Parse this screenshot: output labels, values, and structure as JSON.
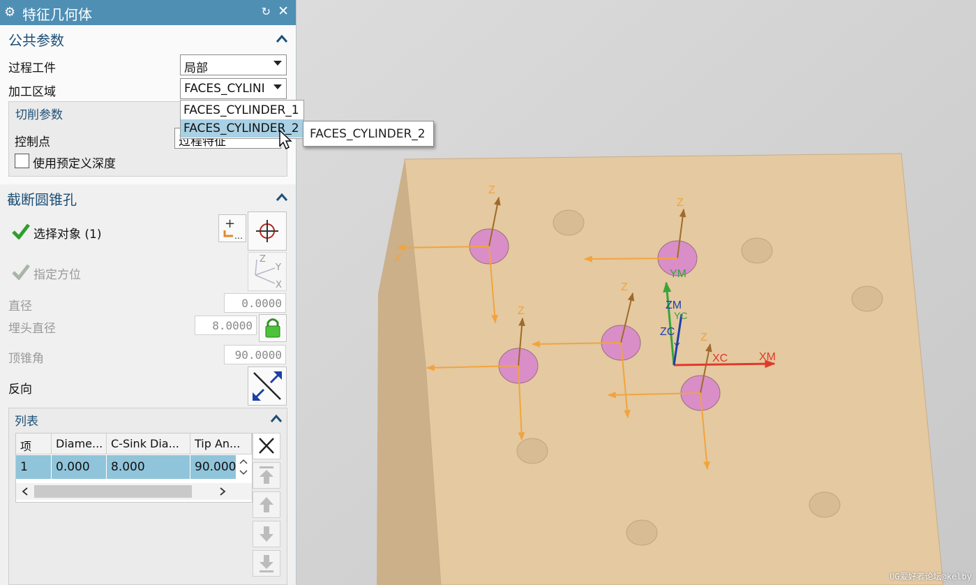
{
  "dialog": {
    "title": "特征几何体",
    "gear_icon": "⚙",
    "reset_icon": "↻",
    "close_icon": "✕",
    "common_params": {
      "title": "公共参数",
      "process_workpiece_label": "过程工件",
      "process_workpiece_value": "局部",
      "machining_area_label": "加工区域",
      "machining_area_value": "FACES_CYLINI",
      "cut_params": {
        "title": "切削参数",
        "control_point_label": "控制点",
        "control_point_value": "过程特征",
        "predef_depth_label": "使用预定义深度",
        "predef_depth_checked": false
      }
    },
    "dropdown": {
      "options": [
        "FACES_CYLINDER_1",
        "FACES_CYLINDER_2"
      ],
      "selected_index": 1
    },
    "tooltip": "FACES_CYLINDER_2",
    "truncated_cone_hole": {
      "title": "截断圆锥孔",
      "select_object_label": "选择对象 (1)",
      "specify_orientation_label": "指定方位",
      "orient_x": "X",
      "orient_y": "Y",
      "orient_z": "Z",
      "diameter_label": "直径",
      "diameter_value": "0.0000",
      "csink_label": "埋头直径",
      "csink_value": "8.0000",
      "tip_angle_label": "顶锥角",
      "tip_angle_value": "90.0000",
      "reverse_label": "反向"
    },
    "list": {
      "title": "列表",
      "columns": [
        "项",
        "Diame...",
        "C-Sink Dia...",
        "Tip An..."
      ],
      "rows": [
        [
          "1",
          "0.000",
          "8.000",
          "90.000"
        ]
      ]
    }
  },
  "viewport": {
    "axis_labels": {
      "z": "Z",
      "x": "X",
      "ym": "YM",
      "zm": "ZM",
      "yc": "YC",
      "zc": "ZC",
      "y": "Y",
      "xc": "XC",
      "xm": "XM"
    },
    "watermark": "UG爱好者论坛@kelby",
    "colors": {
      "block_top": "#e4c9a1",
      "block_side": "#d2b58e",
      "arrow": "#f2a43c",
      "hole": "#d98ec8",
      "xm": "#e03a2a",
      "ym": "#3aa33a",
      "zm": "#1c3fa8"
    }
  }
}
